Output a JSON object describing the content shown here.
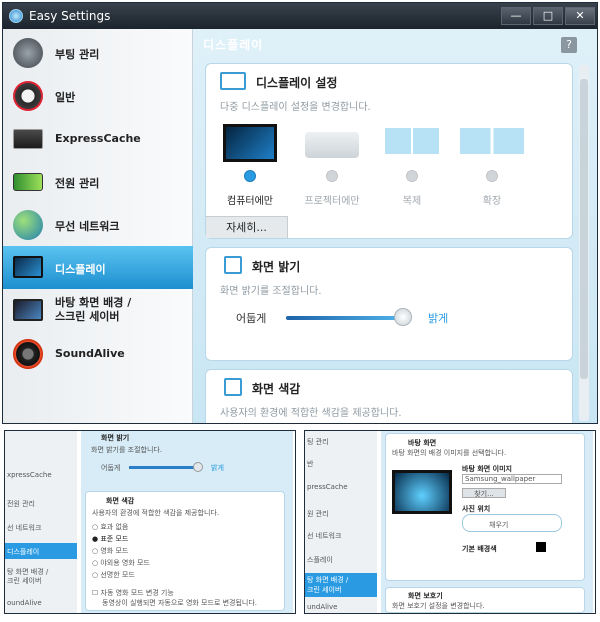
{
  "window": {
    "title": "Easy Settings",
    "minimize": "—",
    "maximize": "□",
    "close": "✕"
  },
  "sidebar": {
    "items": [
      {
        "label": "부팅 관리",
        "icon": "boot-icon"
      },
      {
        "label": "일반",
        "icon": "general-icon"
      },
      {
        "label": "ExpressCache",
        "icon": "ssd-icon"
      },
      {
        "label": "전원 관리",
        "icon": "battery-icon"
      },
      {
        "label": "무선 네트워크",
        "icon": "wireless-globe-icon"
      },
      {
        "label": "디스플레이",
        "icon": "display-icon"
      },
      {
        "label": "바탕 화면 배경 /",
        "label2": "스크린 세이버",
        "icon": "wallpaper-icon"
      },
      {
        "label": "SoundAlive",
        "icon": "speaker-icon"
      }
    ]
  },
  "main": {
    "title": "디스플레이",
    "help": "?",
    "display_settings": {
      "title": "디스플레이 설정",
      "desc": "다중 디스플레이 설정을 변경합니다.",
      "options": [
        "컴퓨터에만",
        "프로젝터에만",
        "복제",
        "확장"
      ],
      "selected": "컴퓨터에만",
      "details_button": "자세히..."
    },
    "brightness": {
      "title": "화면 밝기",
      "desc": "화면 밝기를 조절합니다.",
      "dark_label": "어둡게",
      "bright_label": "밝게",
      "level": 0.95
    },
    "color": {
      "title": "화면 색감",
      "desc": "사용자의 환경에 적합한 색감을 제공합니다."
    }
  },
  "screens": {
    "left": {
      "sidebar": [
        "xpressCache",
        "전원 관리",
        "선 네트워크",
        "디스플레이",
        "탕 화면 배경 /",
        "크린 세이버",
        "oundAlive"
      ],
      "brightness_title": "화면 밝기",
      "brightness_desc": "화면 밝기를 조절합니다.",
      "dark_label": "어둡게",
      "bright_label": "밝게",
      "color_title": "화면 색감",
      "color_desc": "사용자의 환경에 적합한 색감을 제공합니다.",
      "modes": [
        "효과 없음",
        "표준 모드",
        "영화 모드",
        "야외용 영화 모드",
        "선명한 모드"
      ],
      "selected_mode": "표준 모드",
      "auto_label": "자동 영화 모드 변경 기능",
      "auto_desc": "동영상이 실행되면 자동으로 영화 모드로 변경됩니다."
    },
    "right": {
      "sidebar": [
        "팅 관리",
        "반",
        "pressCache",
        "원 관리",
        "선 네트워크",
        "스플레이",
        "탕 화면 배경 /",
        "크린 세이버",
        "undAlive"
      ],
      "wallpaper_title": "바탕 화면",
      "wallpaper_desc": "바탕 화면의 배경 이미지를 선택합니다.",
      "image_label": "바탕 화면 이미지",
      "image_value": "Samsung_wallpaper",
      "browse": "찾기...",
      "position_label": "사진 위치",
      "position_value": "채우기",
      "bgcolor_label": "기본 배경색",
      "saver_title": "화면 보호기",
      "saver_desc": "화면 보호기 설정을 변경합니다."
    }
  }
}
